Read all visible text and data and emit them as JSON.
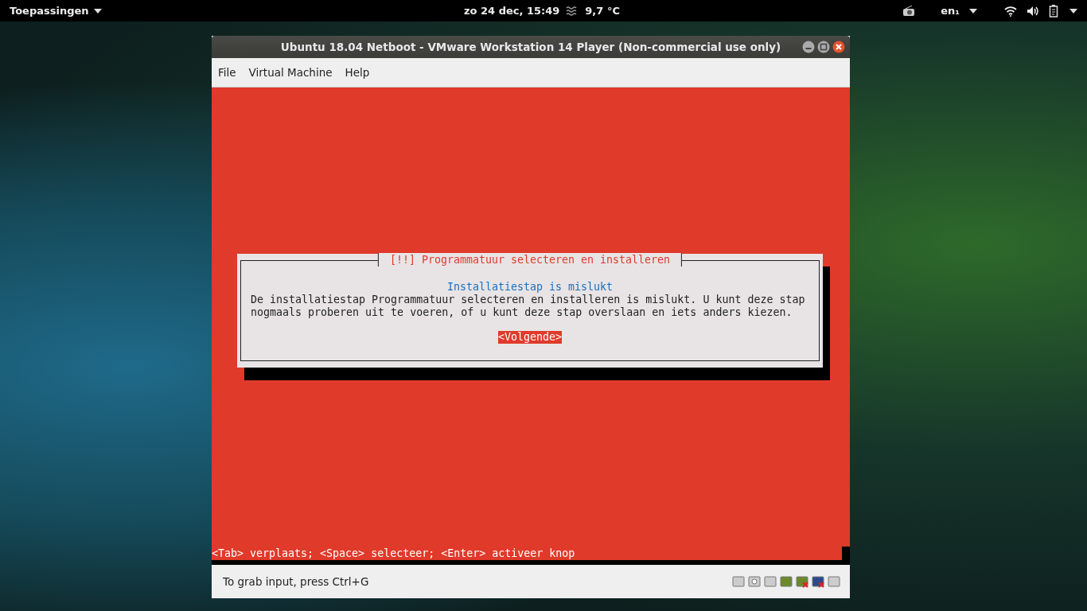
{
  "top_bar": {
    "applications_menu": "Toepassingen",
    "clock": "zo 24 dec, 15:49",
    "weather": "9,7 °C",
    "keyboard_layout": "en₁"
  },
  "window": {
    "title": "Ubuntu 18.04 Netboot - VMware Workstation 14 Player (Non-commercial use only)",
    "menu": [
      "File",
      "Virtual Machine",
      "Help"
    ],
    "dialog": {
      "title": "[!!] Programmatuur selecteren en installeren",
      "heading": "Installatiestap is mislukt",
      "message": "De installatiestap Programmatuur selecteren en installeren is mislukt. U kunt deze stap nogmaals proberen uit te voeren, of u kunt deze stap overslaan en iets anders kiezen.",
      "button": "<Volgende>"
    },
    "help_line": "<Tab> verplaats; <Space> selecteer; <Enter> activeer knop",
    "status_bar": "To grab input, press Ctrl+G"
  }
}
